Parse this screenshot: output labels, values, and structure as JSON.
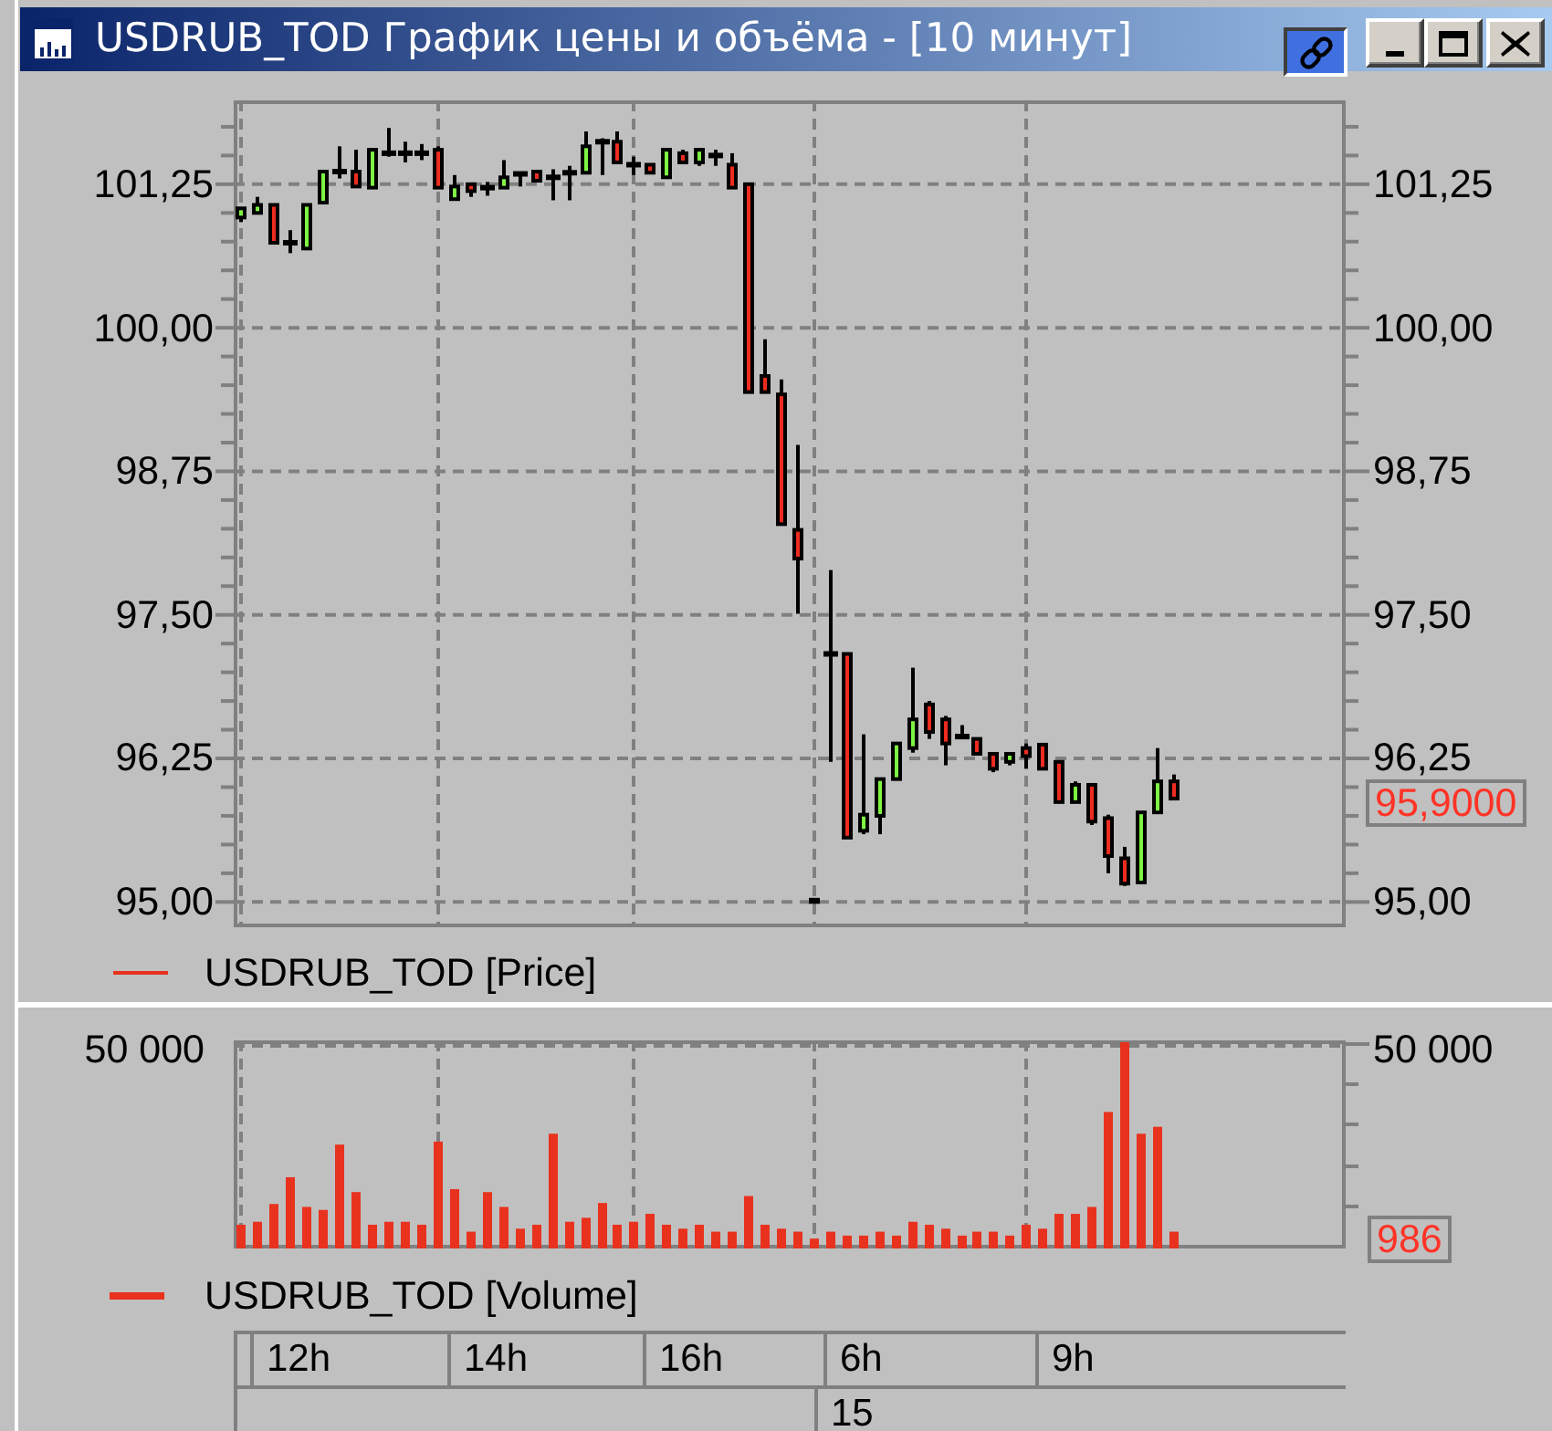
{
  "window": {
    "title": "USDRUB_TOD График цены и объёма - [10 минут]"
  },
  "price_pane": {
    "right_axis": [
      "101,25",
      "100,00",
      "98,75",
      "97,50",
      "96,25",
      "95,00"
    ],
    "last_value": "95,9000",
    "legend": "USDRUB_TOD [Price]",
    "chart_data": {
      "type": "candlestick",
      "categories": [
        null,
        null,
        null,
        null,
        null,
        null,
        null,
        null,
        null,
        null,
        null,
        null,
        null,
        null,
        null,
        null,
        null,
        null,
        null,
        null,
        null,
        null,
        null,
        null,
        null,
        null,
        null,
        null,
        null,
        null,
        null,
        null,
        null,
        null,
        null,
        null,
        null,
        null,
        null,
        null,
        null,
        null,
        null,
        null,
        null,
        null,
        null,
        null,
        null,
        null,
        null,
        null,
        null,
        null,
        null,
        null,
        null,
        null,
        null,
        null,
        null,
        null,
        null,
        null,
        null,
        null,
        null,
        null
      ],
      "ohlc": [
        [
          100.96,
          101.04,
          100.92,
          101.04
        ],
        [
          101.0,
          101.14,
          101.0,
          101.07
        ],
        [
          101.07,
          101.07,
          100.74,
          100.74
        ],
        [
          100.74,
          100.85,
          100.65,
          100.74
        ],
        [
          100.69,
          101.07,
          100.69,
          101.07
        ],
        [
          101.09,
          101.36,
          101.09,
          101.36
        ],
        [
          101.36,
          101.58,
          101.3,
          101.36
        ],
        [
          101.36,
          101.55,
          101.23,
          101.23
        ],
        [
          101.22,
          101.55,
          101.22,
          101.55
        ],
        [
          101.52,
          101.74,
          101.49,
          101.52
        ],
        [
          101.52,
          101.62,
          101.44,
          101.52
        ],
        [
          101.52,
          101.6,
          101.46,
          101.52
        ],
        [
          101.55,
          101.58,
          101.22,
          101.22
        ],
        [
          101.12,
          101.33,
          101.12,
          101.23
        ],
        [
          101.25,
          101.25,
          101.14,
          101.19
        ],
        [
          101.22,
          101.27,
          101.15,
          101.22
        ],
        [
          101.22,
          101.46,
          101.22,
          101.31
        ],
        [
          101.34,
          101.36,
          101.23,
          101.34
        ],
        [
          101.36,
          101.36,
          101.28,
          101.28
        ],
        [
          101.31,
          101.38,
          101.11,
          101.31
        ],
        [
          101.35,
          101.41,
          101.11,
          101.35
        ],
        [
          101.35,
          101.71,
          101.35,
          101.58
        ],
        [
          101.62,
          101.65,
          101.33,
          101.62
        ],
        [
          101.62,
          101.71,
          101.44,
          101.44
        ],
        [
          101.42,
          101.49,
          101.33,
          101.42
        ],
        [
          101.42,
          101.42,
          101.35,
          101.35
        ],
        [
          101.31,
          101.55,
          101.31,
          101.55
        ],
        [
          101.52,
          101.55,
          101.44,
          101.44
        ],
        [
          101.44,
          101.55,
          101.41,
          101.55
        ],
        [
          101.5,
          101.55,
          101.41,
          101.5
        ],
        [
          101.42,
          101.52,
          101.22,
          101.22
        ],
        [
          101.25,
          101.25,
          99.44,
          99.44
        ],
        [
          99.58,
          99.9,
          99.44,
          99.44
        ],
        [
          99.42,
          99.55,
          98.29,
          98.29
        ],
        [
          98.24,
          98.98,
          97.51,
          97.99
        ],
        [
          95.02,
          95.02,
          95.0,
          95.0
        ],
        [
          97.16,
          97.89,
          96.22,
          97.16
        ],
        [
          97.16,
          97.16,
          95.56,
          95.56
        ],
        [
          95.62,
          96.46,
          95.59,
          95.76
        ],
        [
          95.75,
          96.07,
          95.59,
          96.07
        ],
        [
          96.07,
          96.38,
          96.07,
          96.38
        ],
        [
          96.34,
          97.04,
          96.3,
          96.59
        ],
        [
          96.72,
          96.75,
          96.42,
          96.48
        ],
        [
          96.59,
          96.62,
          96.19,
          96.38
        ],
        [
          96.44,
          96.54,
          96.42,
          96.44
        ],
        [
          96.42,
          96.42,
          96.29,
          96.29
        ],
        [
          96.29,
          96.29,
          96.13,
          96.16
        ],
        [
          96.22,
          96.29,
          96.19,
          96.29
        ],
        [
          96.34,
          96.38,
          96.16,
          96.27
        ],
        [
          96.37,
          96.37,
          96.16,
          96.16
        ],
        [
          96.22,
          96.22,
          95.87,
          95.87
        ],
        [
          95.87,
          96.05,
          95.87,
          96.02
        ],
        [
          96.02,
          96.02,
          95.67,
          95.7
        ],
        [
          95.73,
          95.76,
          95.25,
          95.4
        ],
        [
          95.38,
          95.48,
          95.14,
          95.16
        ],
        [
          95.17,
          95.78,
          95.17,
          95.78
        ],
        [
          95.78,
          96.34,
          95.78,
          96.05
        ],
        [
          96.05,
          96.11,
          95.9,
          95.9
        ],
        null,
        null,
        null,
        null,
        null,
        null,
        null,
        null,
        null,
        null
      ],
      "ylim": [
        94.78,
        101.98
      ],
      "grid": true,
      "yticks": [
        {
          "value": 101.25,
          "label": "101,25"
        },
        {
          "value": 100,
          "label": "100,00"
        },
        {
          "value": 98.75,
          "label": "98,75"
        },
        {
          "value": 97.5,
          "label": "97,50"
        },
        {
          "value": 96.25,
          "label": "96,25"
        },
        {
          "value": 95,
          "label": "95,00"
        }
      ]
    }
  },
  "volume_pane": {
    "left_axis": [
      "50 000"
    ],
    "right_axis": [
      "50 000"
    ],
    "last_value": "986",
    "legend": "USDRUB_TOD [Volume]"
  },
  "time_axis": {
    "hours": [
      "12h",
      "14h",
      "16h",
      "6h",
      "9h"
    ],
    "dates": [
      "15"
    ]
  }
}
